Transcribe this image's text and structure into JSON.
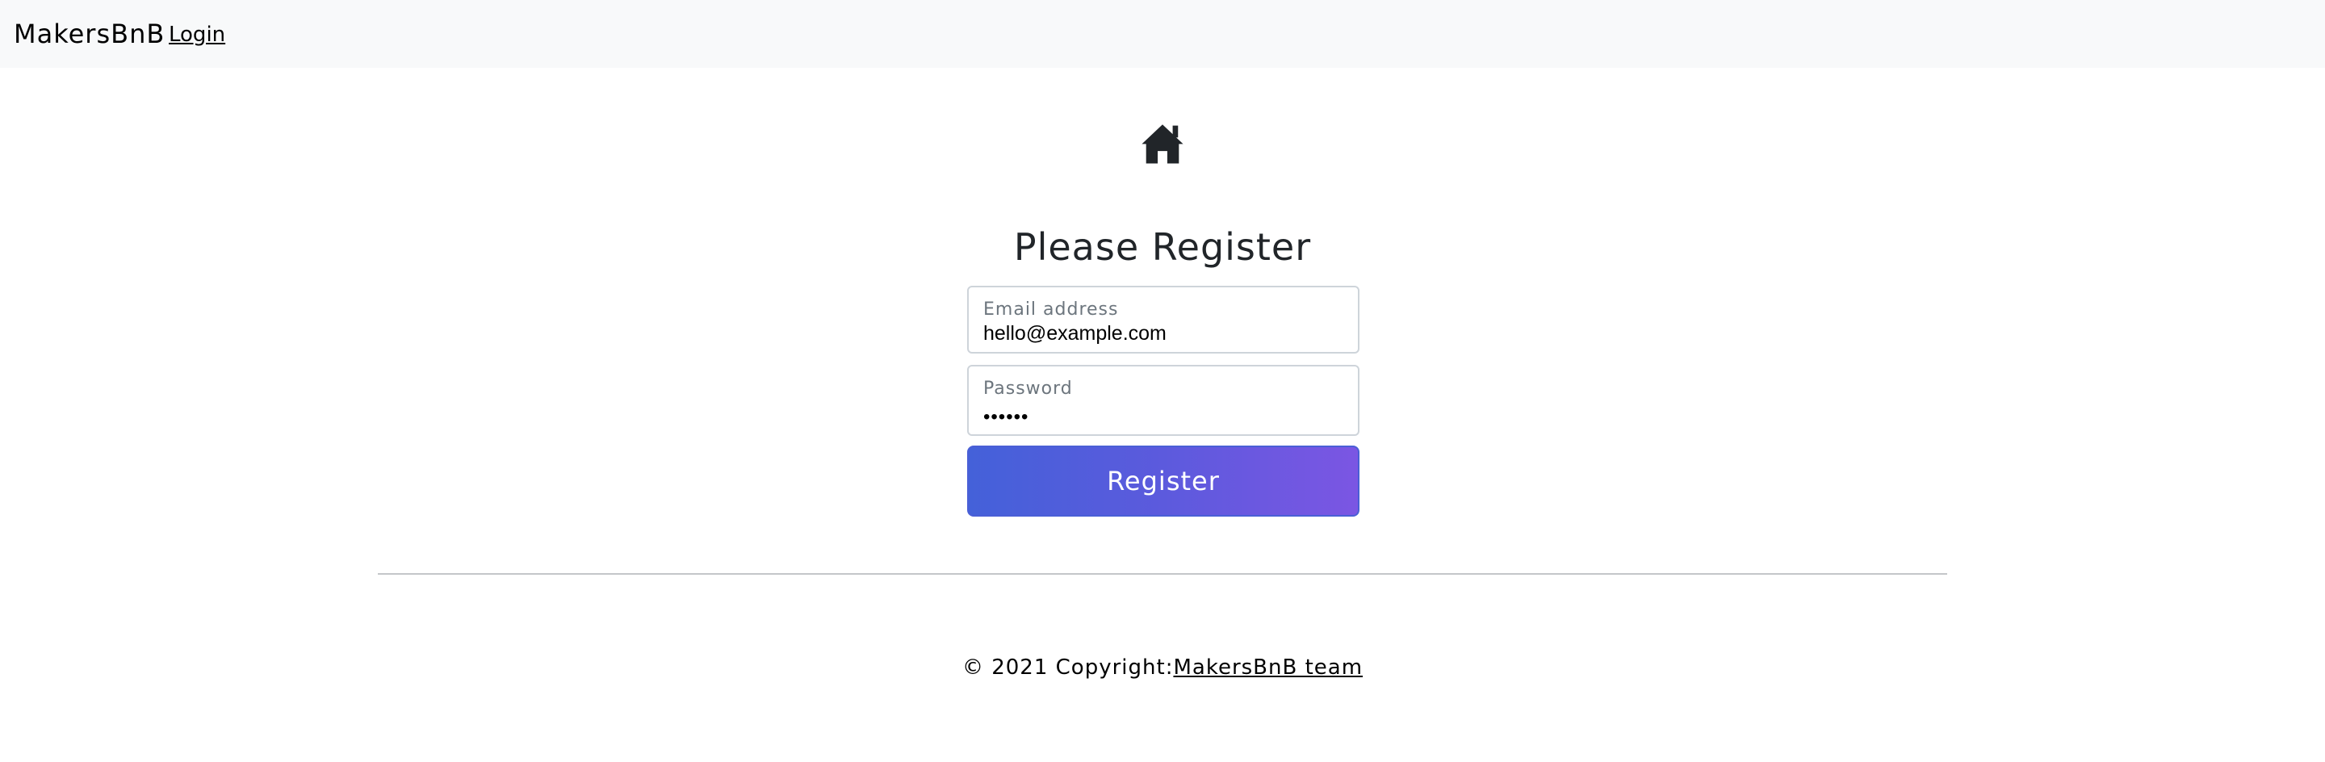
{
  "navbar": {
    "brand": "MakersBnB",
    "login_link": "Login"
  },
  "header": {
    "icon": "house-icon",
    "title": "Please Register"
  },
  "form": {
    "email": {
      "label": "Email address",
      "value": "hello@example.com"
    },
    "password": {
      "label": "Password",
      "value": "••••••"
    },
    "submit_label": "Register"
  },
  "footer": {
    "copyright_text": "© 2021 Copyright:",
    "team_link": "MakersBnB team"
  },
  "colors": {
    "navbar_bg": "#f8f9fa",
    "button_gradient_start": "#4461d9",
    "button_gradient_end": "#7b56e3"
  }
}
